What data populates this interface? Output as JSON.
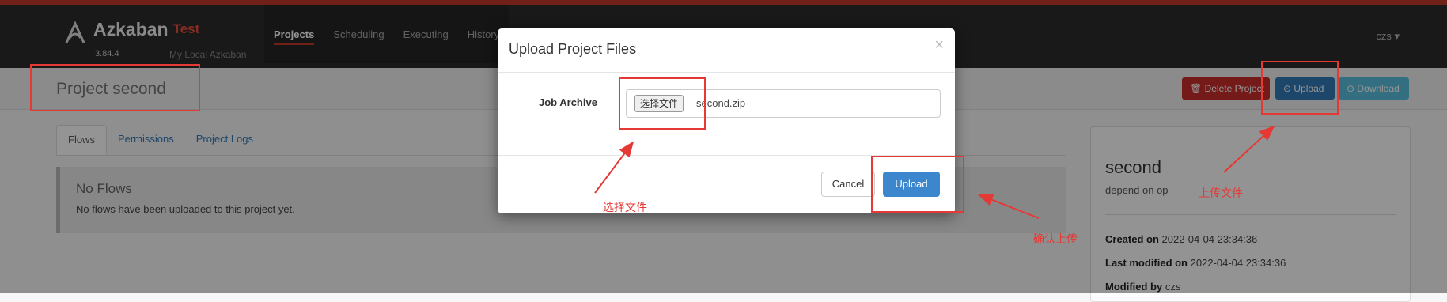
{
  "navbar": {
    "brand": "Azkaban",
    "env": "Test",
    "version": "3.84.4",
    "description": "My Local Azkaban",
    "items": [
      {
        "label": "Projects",
        "active": true
      },
      {
        "label": "Scheduling"
      },
      {
        "label": "Executing"
      },
      {
        "label": "History"
      }
    ],
    "user": "czs ▾"
  },
  "project": {
    "title": "Project second",
    "buttons": {
      "delete": "🗑 Delete Project",
      "upload": "⊙ Upload",
      "download": "⊙ Download"
    }
  },
  "tabs": [
    "Flows",
    "Permissions",
    "Project Logs"
  ],
  "flows": {
    "empty_title": "No Flows",
    "empty_text": "No flows have been uploaded to this project yet."
  },
  "side": {
    "name": "second",
    "description": "depend on op",
    "created_label": "Created on",
    "created_value": "2022-04-04 23:34:36",
    "modified_label": "Last modified on",
    "modified_value": "2022-04-04 23:34:36",
    "modified_by_label": "Modified by",
    "modified_by_value": "czs"
  },
  "modal": {
    "title": "Upload Project Files",
    "close": "×",
    "job_label": "Job Archive",
    "choose_button": "选择文件",
    "file_name": "second.zip",
    "cancel": "Cancel",
    "upload": "Upload"
  },
  "annotations": {
    "choose_file": "选择文件",
    "upload_file": "上传文件",
    "confirm_upload": "确认上传",
    "color": "#e53935"
  },
  "colors": {
    "navbar": "#2b2b2b",
    "accent": "#c0392b",
    "primary": "#337ab7",
    "danger": "#c9302c",
    "info": "#5bc0de"
  }
}
